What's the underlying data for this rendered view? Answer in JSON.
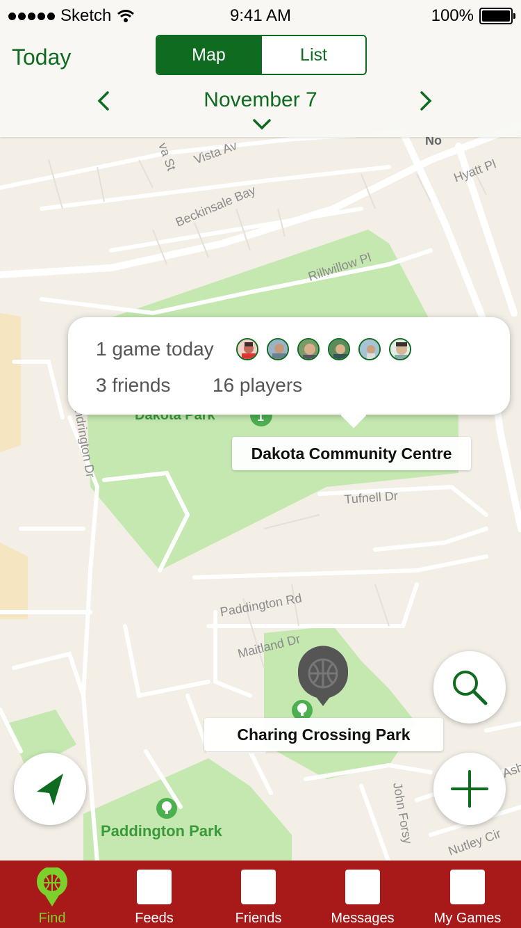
{
  "status_bar": {
    "carrier": "Sketch",
    "time": "9:41 AM",
    "battery": "100%"
  },
  "header": {
    "today_label": "Today",
    "segments": {
      "map_label": "Map",
      "list_label": "List",
      "selected": "Map"
    },
    "date": "November 7"
  },
  "map": {
    "street_labels": {
      "vista": "Vista Av",
      "st": "va St",
      "no": "No",
      "hyatt": "Hyatt Pl",
      "beckinsale": "Beckinsale Bay",
      "rillwillow": "Rillwillow Pl",
      "dakota_park": "Dakota Park",
      "pendrington": "endrington Dr",
      "tufnell": "Tufnell Dr",
      "paddington_rd": "Paddington Rd",
      "maitland": "Maitland Dr",
      "paddington_park": "Paddington Park",
      "john_forsyth": "John Forsy",
      "nutley": "Nutley Cir",
      "ash": "Ash"
    },
    "park_badge": "1"
  },
  "callout": {
    "games_text": "1 game today",
    "friends_text": "3 friends",
    "players_text": "16 players"
  },
  "places": {
    "dakota": "Dakota Community Centre",
    "charing": "Charing Crossing Park"
  },
  "colors": {
    "brand_green": "#0e6b1f",
    "tab_bar_red": "#a81a1a",
    "active_tab": "#7cd02b",
    "park_green": "#c4e8b0"
  },
  "tabs": [
    {
      "label": "Find",
      "icon": "basketball-icon"
    },
    {
      "label": "Feeds",
      "icon": "placeholder-icon"
    },
    {
      "label": "Friends",
      "icon": "placeholder-icon"
    },
    {
      "label": "Messages",
      "icon": "placeholder-icon"
    },
    {
      "label": "My Games",
      "icon": "placeholder-icon"
    }
  ]
}
